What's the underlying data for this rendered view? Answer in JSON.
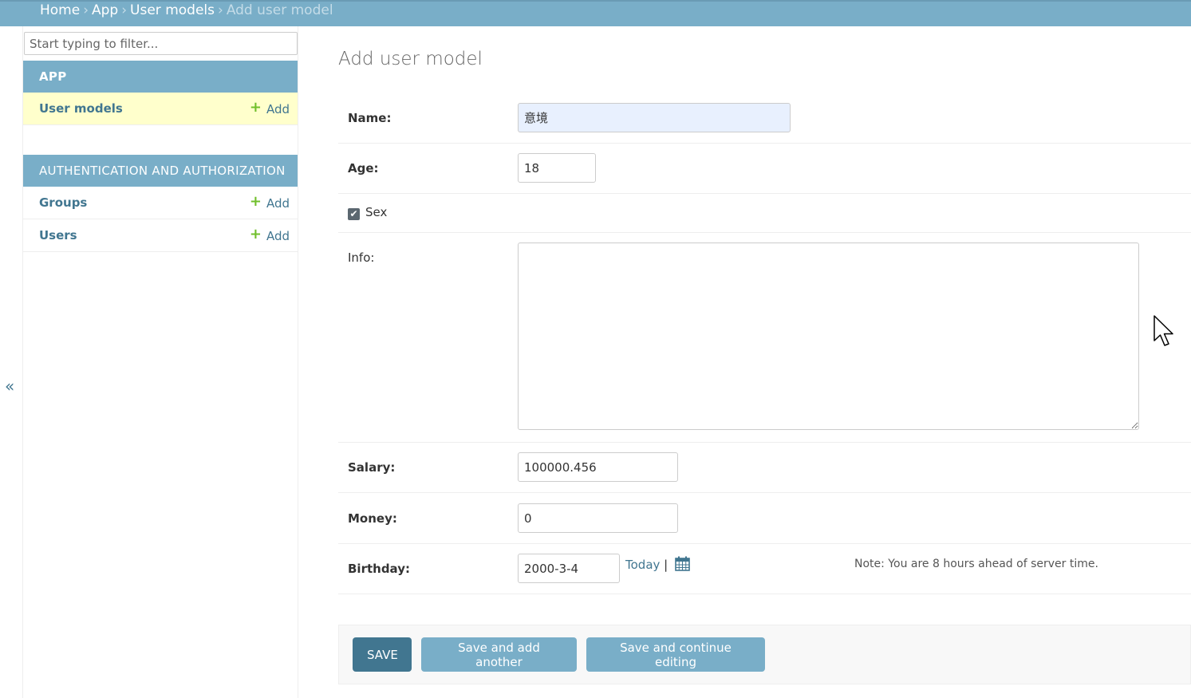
{
  "breadcrumbs": {
    "home": "Home",
    "app": "App",
    "models": "User models",
    "current": "Add user model",
    "separator": "›"
  },
  "sidebar": {
    "filter_placeholder": "Start typing to filter...",
    "modules": [
      {
        "caption": "APP",
        "models": [
          {
            "label": "User models",
            "add_label": "Add",
            "current": true
          }
        ]
      },
      {
        "caption": "AUTHENTICATION AND AUTHORIZATION",
        "models": [
          {
            "label": "Groups",
            "add_label": "Add"
          },
          {
            "label": "Users",
            "add_label": "Add"
          }
        ]
      }
    ],
    "toggle_label": "«",
    "plus_glyph": "+"
  },
  "form": {
    "title": "Add user model",
    "name": {
      "label": "Name:",
      "value": "意境"
    },
    "age": {
      "label": "Age:",
      "value": "18"
    },
    "sex": {
      "label": "Sex",
      "checked": true,
      "check_glyph": "✔"
    },
    "info": {
      "label": "Info:",
      "value": ""
    },
    "salary": {
      "label": "Salary:",
      "value": "100000.456"
    },
    "money": {
      "label": "Money:",
      "value": "0"
    },
    "birthday": {
      "label": "Birthday:",
      "value": "2000-3-4",
      "today_label": "Today",
      "divider": "|",
      "note": "Note: You are 8 hours ahead of server time."
    }
  },
  "buttons": {
    "save": "SAVE",
    "save_add_another": "Save and add another",
    "save_continue": "Save and continue editing"
  },
  "colors": {
    "header": "#79aec8",
    "primary_button": "#417690",
    "secondary_button": "#79aec8",
    "link": "#417690",
    "add_icon": "#70bf2b",
    "current_row": "#ffffcc"
  }
}
